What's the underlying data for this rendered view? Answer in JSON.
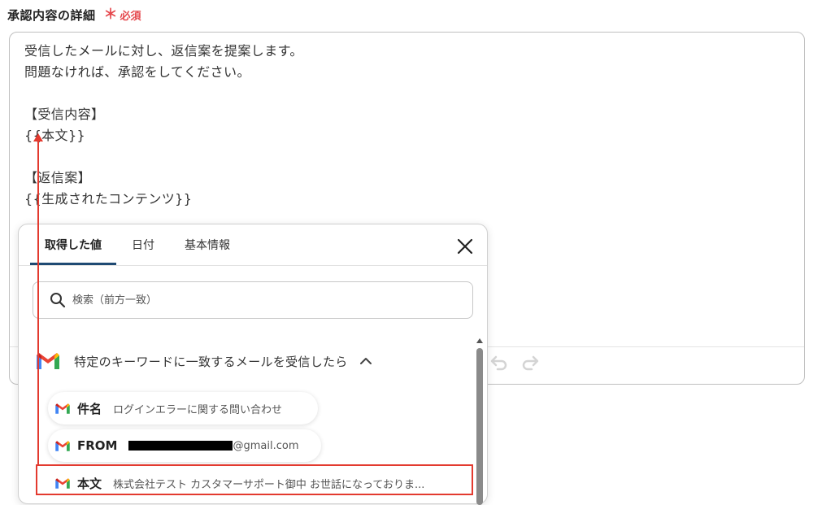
{
  "field": {
    "label": "承認内容の詳細",
    "required_mark": "＊",
    "required_text": "必須"
  },
  "editor": {
    "lines": [
      "受信したメールに対し、返信案を提案します。",
      "問題なければ、承認をしてください。",
      "",
      "【受信内容】",
      "{{本文}}",
      "",
      "【返信案】",
      "{{生成されたコンテンツ}}"
    ]
  },
  "popup": {
    "tabs": [
      "取得した値",
      "日付",
      "基本情報"
    ],
    "active_tab": "取得した値",
    "search": {
      "placeholder": "検索（前方一致）",
      "value": ""
    },
    "group": {
      "title": "特定のキーワードに一致するメールを受信したら"
    },
    "items": [
      {
        "key": "件名",
        "value": "ログインエラーに関する問い合わせ"
      },
      {
        "key": "FROM",
        "value": "@gmail.com",
        "redacted": true
      },
      {
        "key": "本文",
        "value": "株式会社テスト カスタマーサポート御中 お世話になっておりま..."
      }
    ]
  },
  "colors": {
    "required": "#e5484d",
    "tab_underline": "#1f4a73",
    "highlight": "#e33a2f"
  },
  "icons": [
    "undo-icon",
    "redo-icon",
    "close-icon",
    "search-icon",
    "gmail-icon",
    "chevron-up-icon"
  ]
}
